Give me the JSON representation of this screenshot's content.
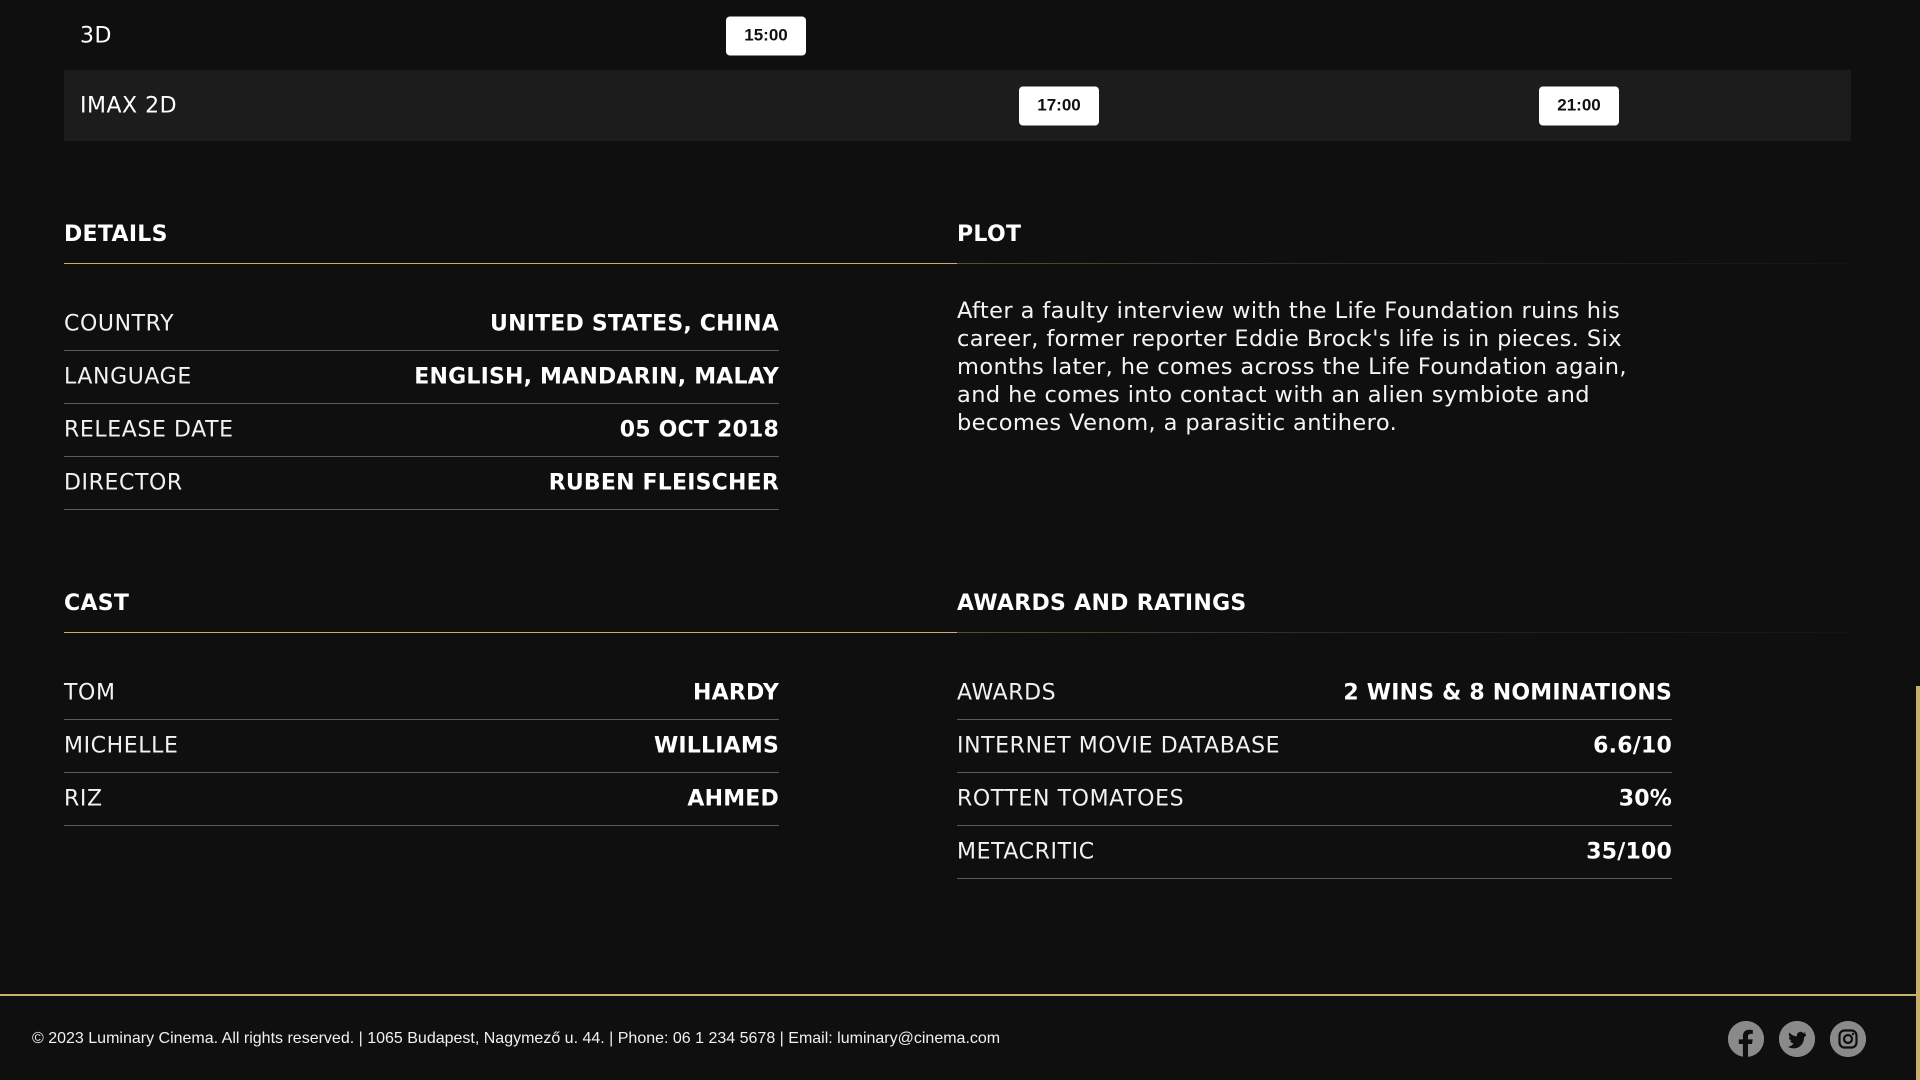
{
  "screenings": [
    {
      "format": "3D",
      "times": [
        "15:00"
      ]
    },
    {
      "format": "IMAX 2D",
      "times": [
        "17:00",
        "21:00"
      ]
    }
  ],
  "details": {
    "title": "DETAILS",
    "rows": [
      {
        "key": "COUNTRY",
        "value": "UNITED STATES, CHINA"
      },
      {
        "key": "LANGUAGE",
        "value": "ENGLISH, MANDARIN, MALAY"
      },
      {
        "key": "RELEASE DATE",
        "value": "05 OCT 2018"
      },
      {
        "key": "DIRECTOR",
        "value": "RUBEN FLEISCHER"
      }
    ]
  },
  "plot": {
    "title": "PLOT",
    "text": "After a faulty interview with the Life Foundation ruins his career, former reporter Eddie Brock's life is in pieces. Six months later, he comes across the Life Foundation again, and he comes into contact with an alien symbiote and becomes Venom, a parasitic antihero."
  },
  "cast": {
    "title": "CAST",
    "rows": [
      {
        "key": "TOM",
        "value": "HARDY"
      },
      {
        "key": "MICHELLE",
        "value": "WILLIAMS"
      },
      {
        "key": "RIZ",
        "value": "AHMED"
      }
    ]
  },
  "awards": {
    "title": "AWARDS AND RATINGS",
    "rows": [
      {
        "key": "AWARDS",
        "value": "2 WINS & 8 NOMINATIONS"
      },
      {
        "key": "INTERNET MOVIE DATABASE",
        "value": "6.6/10"
      },
      {
        "key": "ROTTEN TOMATOES",
        "value": "30%"
      },
      {
        "key": "METACRITIC",
        "value": "35/100"
      }
    ]
  },
  "footer": {
    "text": "© 2023 Luminary Cinema. All rights reserved. | 1065 Budapest, Nagymező u. 44. | Phone: 06 1 234 5678 | Email: luminary@cinema.com",
    "social": [
      "facebook-icon",
      "twitter-icon",
      "instagram-icon"
    ]
  },
  "colors": {
    "background": "#0f0f10",
    "accent": "#c7b06a",
    "row_alt": "#1c1c1d",
    "divider": "#5b5b5b",
    "social_icon": "#8a8a8a"
  }
}
